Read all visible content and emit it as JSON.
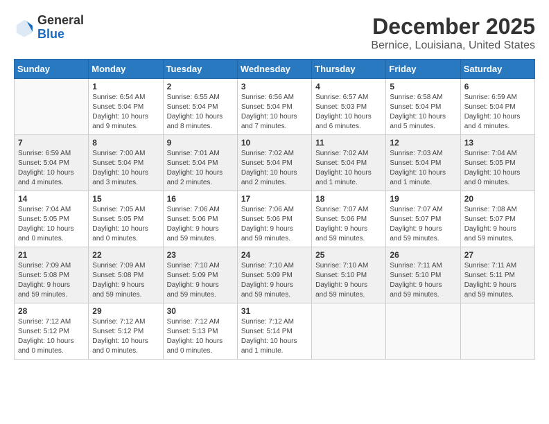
{
  "logo": {
    "general": "General",
    "blue": "Blue"
  },
  "title": "December 2025",
  "subtitle": "Bernice, Louisiana, United States",
  "days": [
    "Sunday",
    "Monday",
    "Tuesday",
    "Wednesday",
    "Thursday",
    "Friday",
    "Saturday"
  ],
  "weeks": [
    [
      {
        "date": "",
        "info": ""
      },
      {
        "date": "1",
        "info": "Sunrise: 6:54 AM\nSunset: 5:04 PM\nDaylight: 10 hours\nand 9 minutes."
      },
      {
        "date": "2",
        "info": "Sunrise: 6:55 AM\nSunset: 5:04 PM\nDaylight: 10 hours\nand 8 minutes."
      },
      {
        "date": "3",
        "info": "Sunrise: 6:56 AM\nSunset: 5:04 PM\nDaylight: 10 hours\nand 7 minutes."
      },
      {
        "date": "4",
        "info": "Sunrise: 6:57 AM\nSunset: 5:03 PM\nDaylight: 10 hours\nand 6 minutes."
      },
      {
        "date": "5",
        "info": "Sunrise: 6:58 AM\nSunset: 5:04 PM\nDaylight: 10 hours\nand 5 minutes."
      },
      {
        "date": "6",
        "info": "Sunrise: 6:59 AM\nSunset: 5:04 PM\nDaylight: 10 hours\nand 4 minutes."
      }
    ],
    [
      {
        "date": "7",
        "info": "Sunrise: 6:59 AM\nSunset: 5:04 PM\nDaylight: 10 hours\nand 4 minutes."
      },
      {
        "date": "8",
        "info": "Sunrise: 7:00 AM\nSunset: 5:04 PM\nDaylight: 10 hours\nand 3 minutes."
      },
      {
        "date": "9",
        "info": "Sunrise: 7:01 AM\nSunset: 5:04 PM\nDaylight: 10 hours\nand 2 minutes."
      },
      {
        "date": "10",
        "info": "Sunrise: 7:02 AM\nSunset: 5:04 PM\nDaylight: 10 hours\nand 2 minutes."
      },
      {
        "date": "11",
        "info": "Sunrise: 7:02 AM\nSunset: 5:04 PM\nDaylight: 10 hours\nand 1 minute."
      },
      {
        "date": "12",
        "info": "Sunrise: 7:03 AM\nSunset: 5:04 PM\nDaylight: 10 hours\nand 1 minute."
      },
      {
        "date": "13",
        "info": "Sunrise: 7:04 AM\nSunset: 5:05 PM\nDaylight: 10 hours\nand 0 minutes."
      }
    ],
    [
      {
        "date": "14",
        "info": "Sunrise: 7:04 AM\nSunset: 5:05 PM\nDaylight: 10 hours\nand 0 minutes."
      },
      {
        "date": "15",
        "info": "Sunrise: 7:05 AM\nSunset: 5:05 PM\nDaylight: 10 hours\nand 0 minutes."
      },
      {
        "date": "16",
        "info": "Sunrise: 7:06 AM\nSunset: 5:06 PM\nDaylight: 9 hours\nand 59 minutes."
      },
      {
        "date": "17",
        "info": "Sunrise: 7:06 AM\nSunset: 5:06 PM\nDaylight: 9 hours\nand 59 minutes."
      },
      {
        "date": "18",
        "info": "Sunrise: 7:07 AM\nSunset: 5:06 PM\nDaylight: 9 hours\nand 59 minutes."
      },
      {
        "date": "19",
        "info": "Sunrise: 7:07 AM\nSunset: 5:07 PM\nDaylight: 9 hours\nand 59 minutes."
      },
      {
        "date": "20",
        "info": "Sunrise: 7:08 AM\nSunset: 5:07 PM\nDaylight: 9 hours\nand 59 minutes."
      }
    ],
    [
      {
        "date": "21",
        "info": "Sunrise: 7:09 AM\nSunset: 5:08 PM\nDaylight: 9 hours\nand 59 minutes."
      },
      {
        "date": "22",
        "info": "Sunrise: 7:09 AM\nSunset: 5:08 PM\nDaylight: 9 hours\nand 59 minutes."
      },
      {
        "date": "23",
        "info": "Sunrise: 7:10 AM\nSunset: 5:09 PM\nDaylight: 9 hours\nand 59 minutes."
      },
      {
        "date": "24",
        "info": "Sunrise: 7:10 AM\nSunset: 5:09 PM\nDaylight: 9 hours\nand 59 minutes."
      },
      {
        "date": "25",
        "info": "Sunrise: 7:10 AM\nSunset: 5:10 PM\nDaylight: 9 hours\nand 59 minutes."
      },
      {
        "date": "26",
        "info": "Sunrise: 7:11 AM\nSunset: 5:10 PM\nDaylight: 9 hours\nand 59 minutes."
      },
      {
        "date": "27",
        "info": "Sunrise: 7:11 AM\nSunset: 5:11 PM\nDaylight: 9 hours\nand 59 minutes."
      }
    ],
    [
      {
        "date": "28",
        "info": "Sunrise: 7:12 AM\nSunset: 5:12 PM\nDaylight: 10 hours\nand 0 minutes."
      },
      {
        "date": "29",
        "info": "Sunrise: 7:12 AM\nSunset: 5:12 PM\nDaylight: 10 hours\nand 0 minutes."
      },
      {
        "date": "30",
        "info": "Sunrise: 7:12 AM\nSunset: 5:13 PM\nDaylight: 10 hours\nand 0 minutes."
      },
      {
        "date": "31",
        "info": "Sunrise: 7:12 AM\nSunset: 5:14 PM\nDaylight: 10 hours\nand 1 minute."
      },
      {
        "date": "",
        "info": ""
      },
      {
        "date": "",
        "info": ""
      },
      {
        "date": "",
        "info": ""
      }
    ]
  ]
}
